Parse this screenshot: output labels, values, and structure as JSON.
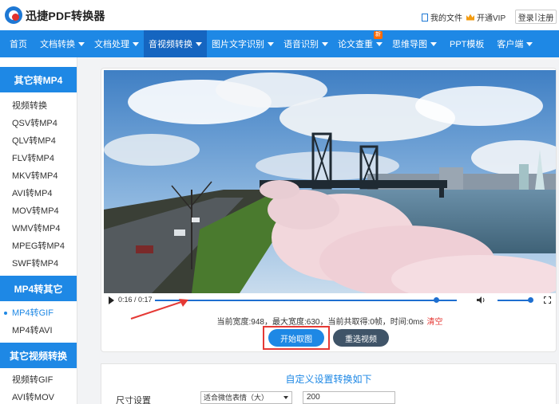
{
  "header": {
    "app_title": "迅捷PDF转换器",
    "my_files": "我的文件",
    "vip": "开通VIP",
    "login": "登录",
    "separator": "|",
    "register": "注册"
  },
  "nav": {
    "items": [
      {
        "label": "首页"
      },
      {
        "label": "文档转换"
      },
      {
        "label": "文档处理"
      },
      {
        "label": "音视频转换"
      },
      {
        "label": "图片文字识别"
      },
      {
        "label": "语音识别"
      },
      {
        "label": "论文查重"
      },
      {
        "label": "思维导图"
      },
      {
        "label": "PPT模板"
      },
      {
        "label": "客户端"
      }
    ],
    "new_badge": "新",
    "active_index": 3
  },
  "sidebar": {
    "section1": {
      "title": "其它转MP4",
      "items": [
        "视频转换",
        "QSV转MP4",
        "QLV转MP4",
        "FLV转MP4",
        "MKV转MP4",
        "AVI转MP4",
        "MOV转MP4",
        "WMV转MP4",
        "MPEG转MP4",
        "SWF转MP4"
      ]
    },
    "section2": {
      "title": "MP4转其它",
      "items": [
        "MP4转GIF",
        "MP4转AVI"
      ],
      "active": "MP4转GIF"
    },
    "section3": {
      "title": "其它视频转换",
      "items": [
        "视频转GIF",
        "AVI转MOV"
      ]
    }
  },
  "player": {
    "time": "0:16 / 0:17",
    "progress_fraction": 0.93,
    "volume_fraction": 1.0
  },
  "info": {
    "text": "当前宽度:948，最大宽度:630，当前共取得:0帧，时间:0ms",
    "clear": "清空"
  },
  "buttons": {
    "start": "开始取图",
    "reselect": "重选视频"
  },
  "settings": {
    "title": "自定义设置转换如下",
    "size_label": "尺寸设置",
    "size_select": "适合微信表情（大）",
    "size_value": "200"
  },
  "colors": {
    "accent": "#1e88e5",
    "highlight": "#e53935"
  }
}
